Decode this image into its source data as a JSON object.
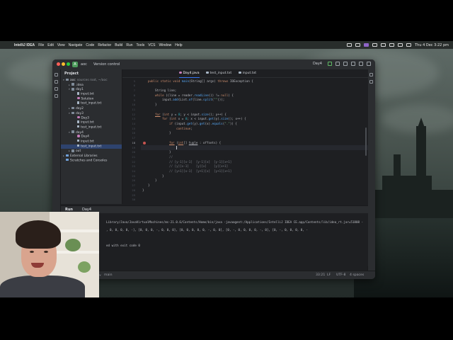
{
  "menubar": {
    "app_name": "IntelliJ IDEA",
    "menus": [
      "File",
      "Edit",
      "View",
      "Navigate",
      "Code",
      "Refactor",
      "Build",
      "Run",
      "Tools",
      "VCS",
      "Window",
      "Help"
    ],
    "clock": "Thu 4 Dec  3:22 pm"
  },
  "titlebar": {
    "project_badge": "A",
    "project_name": "aoc",
    "version_control": "Version control",
    "run_config": "Day4"
  },
  "project_panel": {
    "title": "Project",
    "items": [
      {
        "label": "aoc",
        "extra": "sources root, ~/aoc",
        "type": "folder",
        "indent": 0,
        "toggle": "▾"
      },
      {
        "label": ".idea",
        "type": "folder",
        "indent": 1,
        "toggle": "▸"
      },
      {
        "label": "day1",
        "type": "folder",
        "indent": 1,
        "toggle": "▾"
      },
      {
        "label": "input.txt",
        "type": "file",
        "indent": 2,
        "toggle": ""
      },
      {
        "label": "Solution",
        "type": "java",
        "indent": 2,
        "toggle": ""
      },
      {
        "label": "test_input.txt",
        "type": "file",
        "indent": 2,
        "toggle": ""
      },
      {
        "label": "day2",
        "type": "folder",
        "indent": 1,
        "toggle": "▸"
      },
      {
        "label": "day3",
        "type": "folder",
        "indent": 1,
        "toggle": "▾"
      },
      {
        "label": "Day3",
        "type": "java",
        "indent": 2,
        "toggle": ""
      },
      {
        "label": "input.txt",
        "type": "file",
        "indent": 2,
        "toggle": ""
      },
      {
        "label": "test_input.txt",
        "type": "file",
        "indent": 2,
        "toggle": ""
      },
      {
        "label": "day4",
        "type": "folder",
        "indent": 1,
        "toggle": "▾"
      },
      {
        "label": "Day4",
        "type": "java",
        "indent": 2,
        "toggle": ""
      },
      {
        "label": "input.txt",
        "type": "file",
        "indent": 2,
        "toggle": ""
      },
      {
        "label": "test_input.txt",
        "type": "file",
        "indent": 2,
        "toggle": "",
        "selected": true
      },
      {
        "label": "out",
        "type": "folder",
        "indent": 1,
        "toggle": "▸"
      },
      {
        "label": "External Libraries",
        "type": "libs",
        "indent": 0,
        "toggle": "▸"
      },
      {
        "label": "Scratches and Consoles",
        "type": "libs",
        "indent": 0,
        "toggle": ""
      }
    ]
  },
  "tabs": [
    {
      "label": "Day4.java",
      "active": true,
      "color": "#c77dbb"
    },
    {
      "label": "test_input.txt",
      "active": false,
      "color": "#a9b7c6"
    },
    {
      "label": "input.txt",
      "active": false,
      "color": "#a9b7c6"
    }
  ],
  "editor": {
    "line_numbers": [
      "4",
      "5",
      "6",
      "7",
      "8",
      "9",
      "10",
      "11",
      "12",
      "13",
      "14",
      "15",
      "16",
      "17",
      "18",
      "19",
      "20",
      "21",
      "22",
      "23",
      "24",
      "25",
      "26",
      "27",
      "28",
      "29",
      "30"
    ],
    "current_line": "18"
  },
  "run_panel": {
    "title": "Run",
    "tab": "Day4",
    "console_lines": [
      "Library/Java/JavaVirtualMachines/ms-21.0.6/Contents/Home/bin/java -javaagent:/Applications/IntelliJ IDEA CE.app/Contents/lib/idea_rt.jar=51808 -",
      ", 0, 0, 0, 0, -], [0, 0, 0, -, 0, 0, 0], [0, 0, 0, 0, 0, -, 0, 0], [0, -, 0, 0, 0, 0, -, 0], [0, -, 0, 0, 0, 0, -",
      "",
      "ed with exit code 0"
    ]
  },
  "statusbar": {
    "branch": "main",
    "position": "33:21",
    "line_sep": "LF",
    "encoding": "UTF-8",
    "indent": "4 spaces"
  },
  "colors": {
    "accent": "#3574f0",
    "editor_bg": "#1e1f22",
    "panel_bg": "#2b2d30",
    "keyword": "#cf8e6d",
    "string": "#6aab73",
    "function": "#56a8f5",
    "comment": "#7a7e85"
  }
}
